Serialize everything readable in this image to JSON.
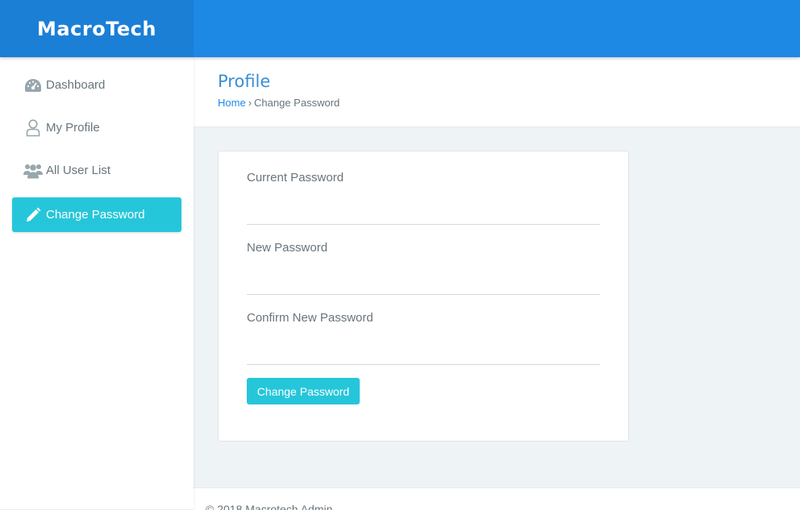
{
  "brand": {
    "name": "MacroTech"
  },
  "colors": {
    "topbar": "#1e88e5",
    "accent": "#26c6da",
    "link": "#1e88e5",
    "text": "#67757c"
  },
  "sidebar": {
    "items": [
      {
        "label": "Dashboard",
        "icon": "dashboard-gauge-icon",
        "active": false
      },
      {
        "label": "My Profile",
        "icon": "user-icon",
        "active": false
      },
      {
        "label": "All User List",
        "icon": "users-icon",
        "active": false
      },
      {
        "label": "Change Password",
        "icon": "pencil-icon",
        "active": true
      }
    ]
  },
  "page": {
    "title": "Profile",
    "breadcrumb": {
      "home": "Home",
      "separator": "›",
      "current": "Change Password"
    }
  },
  "form": {
    "current_password": {
      "label": "Current Password",
      "value": ""
    },
    "new_password": {
      "label": "New Password",
      "value": ""
    },
    "confirm_password": {
      "label": "Confirm New Password",
      "value": ""
    },
    "submit_label": "Change Password"
  },
  "footer": {
    "text": "© 2018 Macrotech Admin"
  }
}
